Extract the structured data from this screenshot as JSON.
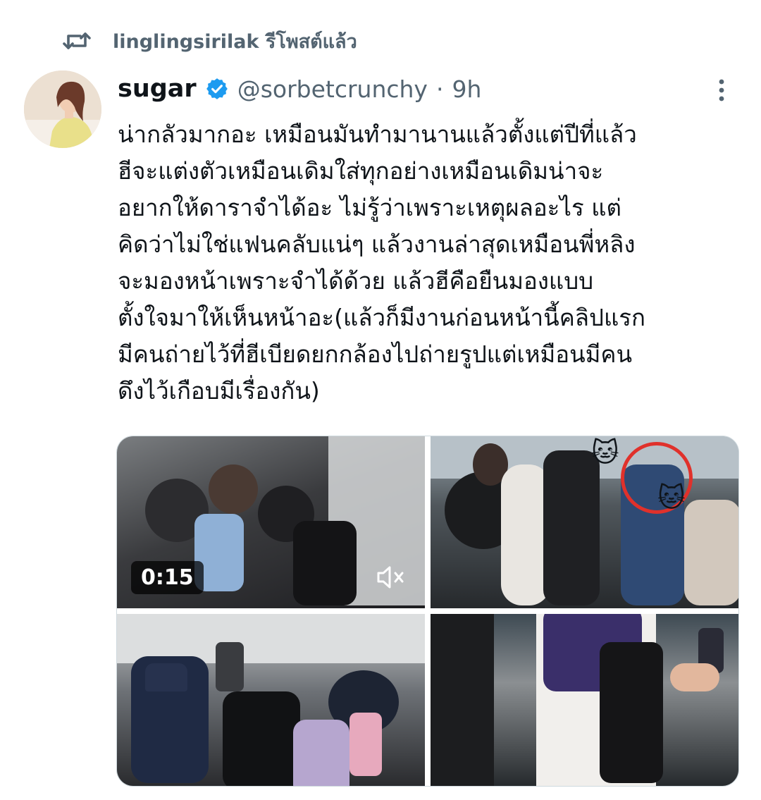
{
  "repost": {
    "icon": "repost-icon",
    "text": "linglingsirilak รีโพสต์แล้ว"
  },
  "author": {
    "display_name": "sugar",
    "verified": true,
    "handle": "@sorbetcrunchy",
    "separator": "·",
    "time": "9h",
    "avatar_icon": "avatar"
  },
  "tweet": {
    "lines": [
      "น่ากลัวมากอะ เหมือนมันทำมานานแล้วตั้งแต่ปีที่แล้ว",
      "ฮีจะแต่งตัวเหมือนเดิมใส่ทุกอย่างเหมือนเดิมน่าจะ",
      "อยากให้ดาราจำได้อะ ไม่รู้ว่าเพราะเหตุผลอะไร แต่",
      "คิดว่าไม่ใช่แฟนคลับแน่ๆ แล้วงานล่าสุดเหมือนพี่หลิง",
      "จะมองหน้าเพราะจำได้ด้วย แล้วฮีคือยืนมองแบบ",
      "ตั้งใจมาให้เห็นหน้าอะ(แล้วก็มีงานก่อนหน้านี้คลิปแรก",
      "มีคนถ่ายไว้ที่ฮีเบียดยกกล้องไปถ่ายรูปแต่เหมือนมีคน",
      "ดึงไว้เกือบมีเรื่องกัน)"
    ]
  },
  "media": {
    "video_duration": "0:15",
    "mute_icon": "muted-speaker-icon",
    "cat_emoji": "🐱",
    "colors": {
      "accent": "#1d9bf0",
      "secondary_text": "#536471",
      "annotation_red": "#e0312b"
    }
  }
}
